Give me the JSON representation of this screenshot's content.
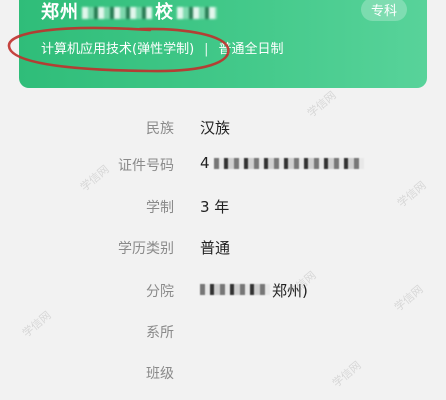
{
  "header": {
    "school_prefix": "郑州",
    "school_mid": "校",
    "level_badge": "专科",
    "major": "计算机应用技术(弹性学制)",
    "separator": "|",
    "study_mode": "普通全日制"
  },
  "fields": {
    "ethnicity": {
      "label": "民族",
      "value": "汉族"
    },
    "id_number": {
      "label": "证件号码",
      "value": "4"
    },
    "duration": {
      "label": "学制",
      "value": "3 年"
    },
    "category": {
      "label": "学历类别",
      "value": "普通"
    },
    "branch": {
      "label": "分院",
      "value": "郑州)"
    },
    "department": {
      "label": "系所",
      "value": ""
    },
    "class": {
      "label": "班级",
      "value": ""
    }
  },
  "watermark": {
    "text": "学信网"
  },
  "colors": {
    "header_green": "#3fc486",
    "annotation_red": "#c0302b",
    "label_gray": "#8a8a8a",
    "value_dark": "#222222"
  }
}
